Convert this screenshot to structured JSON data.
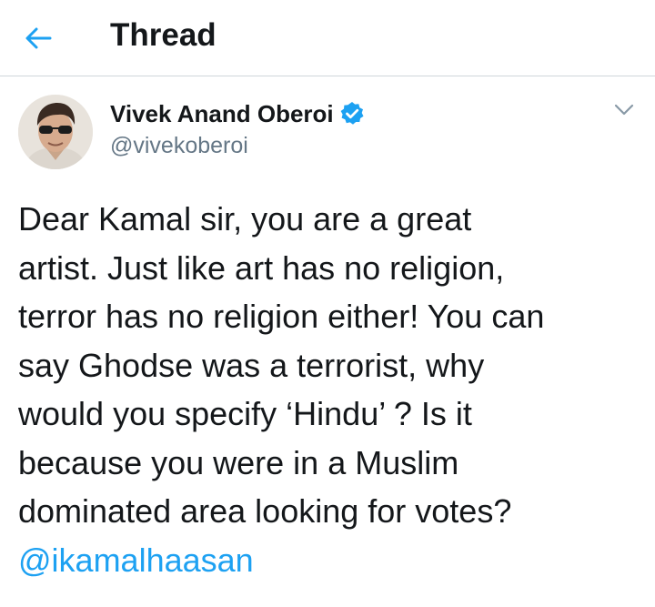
{
  "header": {
    "title": "Thread",
    "back_icon": "arrow-left-icon"
  },
  "tweet": {
    "author": {
      "name": "Vivek Anand Oberoi",
      "handle": "@vivekoberoi",
      "verified": true
    },
    "text_lines": [
      "Dear Kamal sir, you are a great",
      "artist. Just like art has no religion,",
      "terror has no religion either! You can",
      "say Ghodse was a terrorist, why",
      "would you specify ‘Hindu’ ? Is it",
      "because you were in a Muslim",
      "dominated area looking for votes?"
    ],
    "mention": "@ikamalhaasan",
    "menu_icon": "chevron-down-icon"
  },
  "colors": {
    "accent": "#1da1f2",
    "text": "#14171a",
    "muted": "#657786",
    "divider": "#d0d6db"
  }
}
